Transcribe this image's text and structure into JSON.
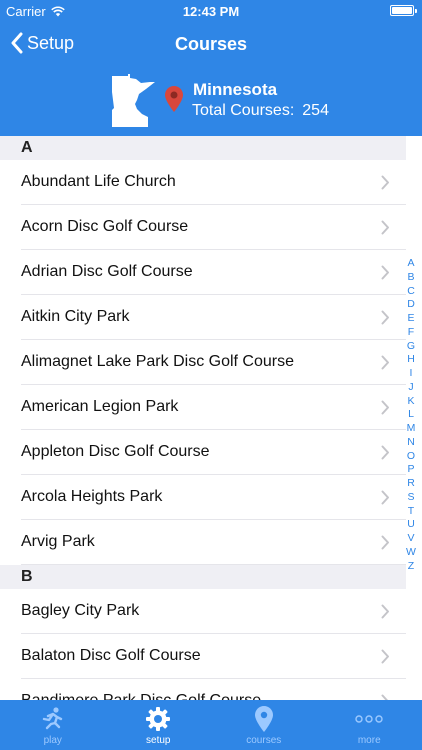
{
  "status_bar": {
    "carrier": "Carrier",
    "time": "12:43 PM"
  },
  "nav": {
    "back_label": "Setup",
    "title": "Courses"
  },
  "state": {
    "name": "Minnesota",
    "total_label": "Total Courses:",
    "total": "254"
  },
  "sections": [
    {
      "letter": "A",
      "items": [
        "Abundant Life Church",
        "Acorn Disc Golf Course",
        "Adrian Disc Golf Course",
        "Aitkin City Park",
        "Alimagnet Lake Park Disc Golf Course",
        "American Legion Park",
        "Appleton Disc Golf Course",
        "Arcola Heights Park",
        "Arvig Park"
      ]
    },
    {
      "letter": "B",
      "items": [
        "Bagley City Park",
        "Balaton Disc Golf Course",
        "Bandimere Park Disc Golf Course"
      ]
    }
  ],
  "index_letters": [
    "A",
    "B",
    "C",
    "D",
    "E",
    "F",
    "G",
    "H",
    "I",
    "J",
    "K",
    "L",
    "M",
    "N",
    "O",
    "P",
    "R",
    "S",
    "T",
    "U",
    "V",
    "W",
    "Z"
  ],
  "tabs": [
    {
      "label": "play",
      "icon": "runner-icon",
      "active": false
    },
    {
      "label": "setup",
      "icon": "gear-icon",
      "active": true
    },
    {
      "label": "courses",
      "icon": "map-pin-icon",
      "active": false
    },
    {
      "label": "more",
      "icon": "more-dots-icon",
      "active": false
    }
  ],
  "colors": {
    "accent": "#2f86e6",
    "tab_inactive": "#9cc9ff",
    "pin": "#d9473c"
  }
}
